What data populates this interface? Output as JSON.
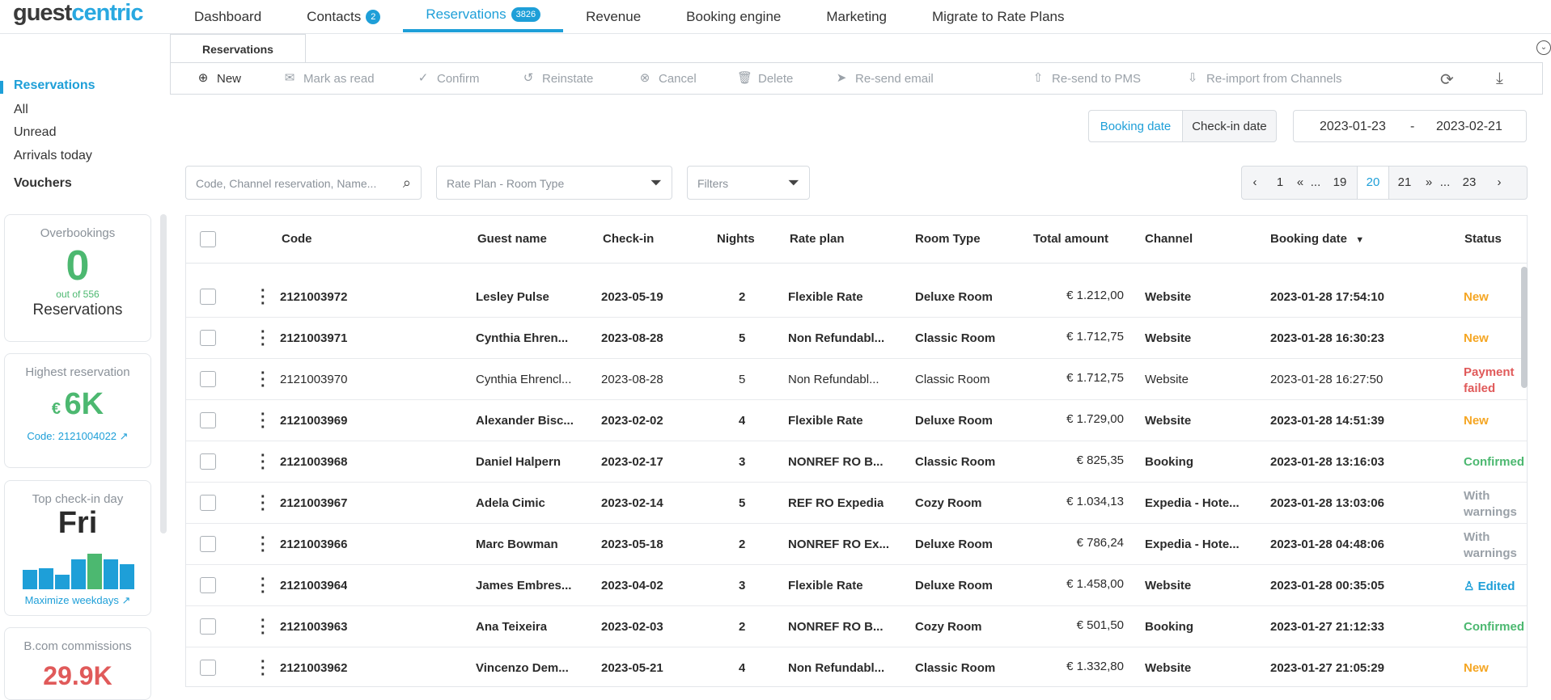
{
  "logo": {
    "part1": "guest",
    "part2": "centric"
  },
  "nav": {
    "items": [
      {
        "label": "Dashboard",
        "badge": null
      },
      {
        "label": "Contacts",
        "badge": "2"
      },
      {
        "label": "Reservations",
        "badge": "3826"
      },
      {
        "label": "Revenue",
        "badge": null
      },
      {
        "label": "Booking engine",
        "badge": null
      },
      {
        "label": "Marketing",
        "badge": null
      },
      {
        "label": "Migrate to Rate Plans",
        "badge": null
      }
    ],
    "active_index": 2
  },
  "subtab": {
    "label": "Reservations"
  },
  "toolbar": {
    "new": "New",
    "mark_read": "Mark as read",
    "confirm": "Confirm",
    "reinstate": "Reinstate",
    "cancel": "Cancel",
    "delete": "Delete",
    "resend_email": "Re-send email",
    "resend_pms": "Re-send to PMS",
    "reimport": "Re-import from Channels"
  },
  "sidebar": {
    "reservations": "Reservations",
    "all": "All",
    "unread": "Unread",
    "arrivals": "Arrivals today",
    "vouchers": "Vouchers"
  },
  "cards": {
    "overbookings": {
      "title": "Overbookings",
      "value": "0",
      "sub": "out of 556",
      "label": "Reservations"
    },
    "highest": {
      "title": "Highest reservation",
      "currency": "€",
      "value": "6K",
      "code": "Code: 2121004022"
    },
    "topday": {
      "title": "Top check-in day",
      "value": "Fri",
      "link": "Maximize weekdays",
      "bars": [
        0.55,
        0.6,
        0.4,
        0.85,
        1.0,
        0.85,
        0.7
      ]
    },
    "commissions": {
      "title": "B.com commissions",
      "value": "29.9K"
    }
  },
  "datefilter": {
    "booking": "Booking date",
    "checkin": "Check-in date",
    "from": "2023-01-23",
    "sep": "-",
    "to": "2023-02-21"
  },
  "search": {
    "placeholder": "Code, Channel reservation, Name..."
  },
  "rateplan_filter": {
    "placeholder": "Rate Plan - Room Type"
  },
  "filters": {
    "placeholder": "Filters"
  },
  "pager": {
    "p1": "1",
    "ell1": "...",
    "p19": "19",
    "p20": "20",
    "p21": "21",
    "ell2": "...",
    "p23": "23"
  },
  "table": {
    "headers": {
      "code": "Code",
      "guest": "Guest name",
      "checkin": "Check-in",
      "nights": "Nights",
      "rate": "Rate plan",
      "room": "Room Type",
      "total": "Total amount",
      "channel": "Channel",
      "booking": "Booking date",
      "status": "Status"
    },
    "rows": [
      {
        "code": "2121003972",
        "guest": "Lesley Pulse",
        "checkin": "2023-05-19",
        "nights": "2",
        "rate": "Flexible Rate",
        "room": "Deluxe Room",
        "total": "€ 1.212,00",
        "channel": "Website",
        "booking": "2023-01-28 17:54:10",
        "status": "New",
        "status2": "",
        "status_color": "#f5a623",
        "bold": true
      },
      {
        "code": "2121003971",
        "guest": "Cynthia Ehren...",
        "checkin": "2023-08-28",
        "nights": "5",
        "rate": "Non Refundabl...",
        "room": "Classic Room",
        "total": "€ 1.712,75",
        "channel": "Website",
        "booking": "2023-01-28 16:30:23",
        "status": "New",
        "status2": "",
        "status_color": "#f5a623",
        "bold": true
      },
      {
        "code": "2121003970",
        "guest": "Cynthia Ehrencl...",
        "checkin": "2023-08-28",
        "nights": "5",
        "rate": "Non Refundabl...",
        "room": "Classic Room",
        "total": "€ 1.712,75",
        "channel": "Website",
        "booking": "2023-01-28 16:27:50",
        "status": "Payment",
        "status2": "failed",
        "status_color": "#e05a5a",
        "bold": false
      },
      {
        "code": "2121003969",
        "guest": "Alexander Bisc...",
        "checkin": "2023-02-02",
        "nights": "4",
        "rate": "Flexible Rate",
        "room": "Deluxe Room",
        "total": "€ 1.729,00",
        "channel": "Website",
        "booking": "2023-01-28 14:51:39",
        "status": "New",
        "status2": "",
        "status_color": "#f5a623",
        "bold": true
      },
      {
        "code": "2121003968",
        "guest": "Daniel Halpern",
        "checkin": "2023-02-17",
        "nights": "3",
        "rate": "NONREF RO B...",
        "room": "Classic Room",
        "total": "€ 825,35",
        "channel": "Booking",
        "booking": "2023-01-28 13:16:03",
        "status": "Confirmed",
        "status2": "",
        "status_color": "#4cb870",
        "bold": true
      },
      {
        "code": "2121003967",
        "guest": "Adela Cimic",
        "checkin": "2023-02-14",
        "nights": "5",
        "rate": "REF RO Expedia",
        "room": "Cozy Room",
        "total": "€ 1.034,13",
        "channel": "Expedia - Hote...",
        "booking": "2023-01-28 13:03:06",
        "status": "With",
        "status2": "warnings",
        "status_color": "#9aa1a8",
        "bold": true
      },
      {
        "code": "2121003966",
        "guest": "Marc Bowman",
        "checkin": "2023-05-18",
        "nights": "2",
        "rate": "NONREF RO Ex...",
        "room": "Deluxe Room",
        "total": "€ 786,24",
        "channel": "Expedia - Hote...",
        "booking": "2023-01-28 04:48:06",
        "status": "With",
        "status2": "warnings",
        "status_color": "#9aa1a8",
        "bold": true
      },
      {
        "code": "2121003964",
        "guest": "James Embres...",
        "checkin": "2023-04-02",
        "nights": "3",
        "rate": "Flexible Rate",
        "room": "Deluxe Room",
        "total": "€ 1.458,00",
        "channel": "Website",
        "booking": "2023-01-28 00:35:05",
        "status": "Edited",
        "status2": "",
        "status_color": "#1e9fd8",
        "bold": true
      },
      {
        "code": "2121003963",
        "guest": "Ana Teixeira",
        "checkin": "2023-02-03",
        "nights": "2",
        "rate": "NONREF RO B...",
        "room": "Cozy Room",
        "total": "€ 501,50",
        "channel": "Booking",
        "booking": "2023-01-27 21:12:33",
        "status": "Confirmed",
        "status2": "",
        "status_color": "#4cb870",
        "bold": true
      },
      {
        "code": "2121003962",
        "guest": "Vincenzo Dem...",
        "checkin": "2023-05-21",
        "nights": "4",
        "rate": "Non Refundabl...",
        "room": "Classic Room",
        "total": "€ 1.332,80",
        "channel": "Website",
        "booking": "2023-01-27 21:05:29",
        "status": "New",
        "status2": "",
        "status_color": "#f5a623",
        "bold": true
      }
    ]
  }
}
